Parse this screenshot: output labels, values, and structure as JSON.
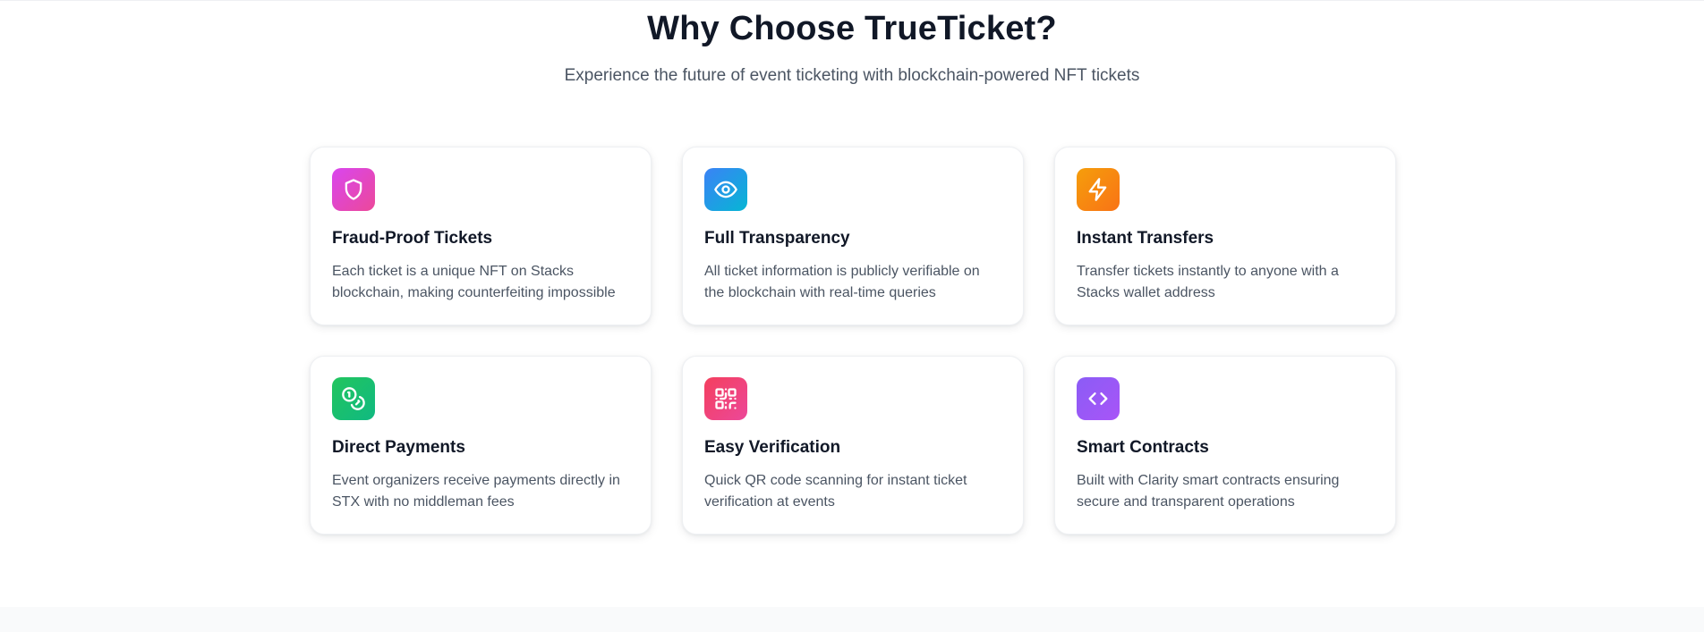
{
  "section": {
    "title": "Why Choose TrueTicket?",
    "subtitle": "Experience the future of event ticketing with blockchain-powered NFT tickets"
  },
  "features": [
    {
      "icon": "shield-icon",
      "title": "Fraud-Proof Tickets",
      "description": "Each ticket is a unique NFT on Stacks blockchain, making counterfeiting impossible",
      "gradient": [
        "#d946ef",
        "#ec4899"
      ]
    },
    {
      "icon": "eye-icon",
      "title": "Full Transparency",
      "description": "All ticket information is publicly verifiable on the blockchain with real-time queries",
      "gradient": [
        "#3b82f6",
        "#06b6d4"
      ]
    },
    {
      "icon": "lightning-icon",
      "title": "Instant Transfers",
      "description": "Transfer tickets instantly to anyone with a Stacks wallet address",
      "gradient": [
        "#f59e0b",
        "#f97316"
      ]
    },
    {
      "icon": "coins-icon",
      "title": "Direct Payments",
      "description": "Event organizers receive payments directly in STX with no middleman fees",
      "gradient": [
        "#22c55e",
        "#10b981"
      ]
    },
    {
      "icon": "qr-code-icon",
      "title": "Easy Verification",
      "description": "Quick QR code scanning for instant ticket verification at events",
      "gradient": [
        "#f43f5e",
        "#ec4899"
      ]
    },
    {
      "icon": "code-icon",
      "title": "Smart Contracts",
      "description": "Built with Clarity smart contracts ensuring secure and transparent operations",
      "gradient": [
        "#8b5cf6",
        "#a855f7"
      ]
    }
  ]
}
